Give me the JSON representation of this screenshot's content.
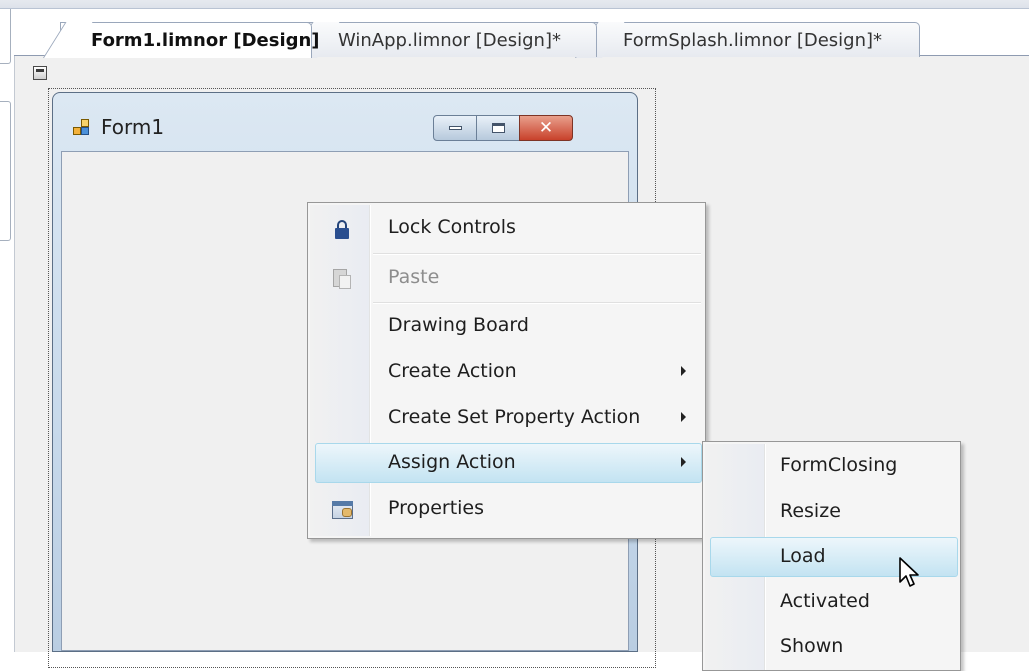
{
  "tabs": [
    {
      "label": "Form1.limnor [Design]",
      "active": true
    },
    {
      "label": "WinApp.limnor [Design]*",
      "active": false
    },
    {
      "label": "FormSplash.limnor [Design]*",
      "active": false
    }
  ],
  "form": {
    "title": "Form1",
    "minimize_icon": "minimize-icon",
    "maximize_icon": "maximize-icon",
    "close_icon": "close-icon"
  },
  "context_menu": {
    "items": [
      {
        "label": "Lock Controls",
        "icon": "lock-icon",
        "enabled": true
      },
      {
        "label": "Paste",
        "icon": "paste-icon",
        "enabled": false
      },
      {
        "label": "Drawing Board",
        "icon": null,
        "enabled": true
      },
      {
        "label": "Create Action",
        "icon": null,
        "enabled": true,
        "submenu": true
      },
      {
        "label": "Create Set Property Action",
        "icon": null,
        "enabled": true,
        "submenu": true
      },
      {
        "label": "Assign Action",
        "icon": null,
        "enabled": true,
        "submenu": true,
        "highlighted": true
      },
      {
        "label": "Properties",
        "icon": "properties-icon",
        "enabled": true
      }
    ]
  },
  "submenu": {
    "parent": "Assign Action",
    "items": [
      {
        "label": "FormClosing"
      },
      {
        "label": "Resize"
      },
      {
        "label": "Load",
        "highlighted": true
      },
      {
        "label": "Activated"
      },
      {
        "label": "Shown"
      }
    ]
  },
  "colors": {
    "highlight_fill": "#d6ecf6",
    "highlight_border": "#a8d8eb",
    "disabled_text": "#8d8d8d",
    "close_button": "#c8412b"
  }
}
